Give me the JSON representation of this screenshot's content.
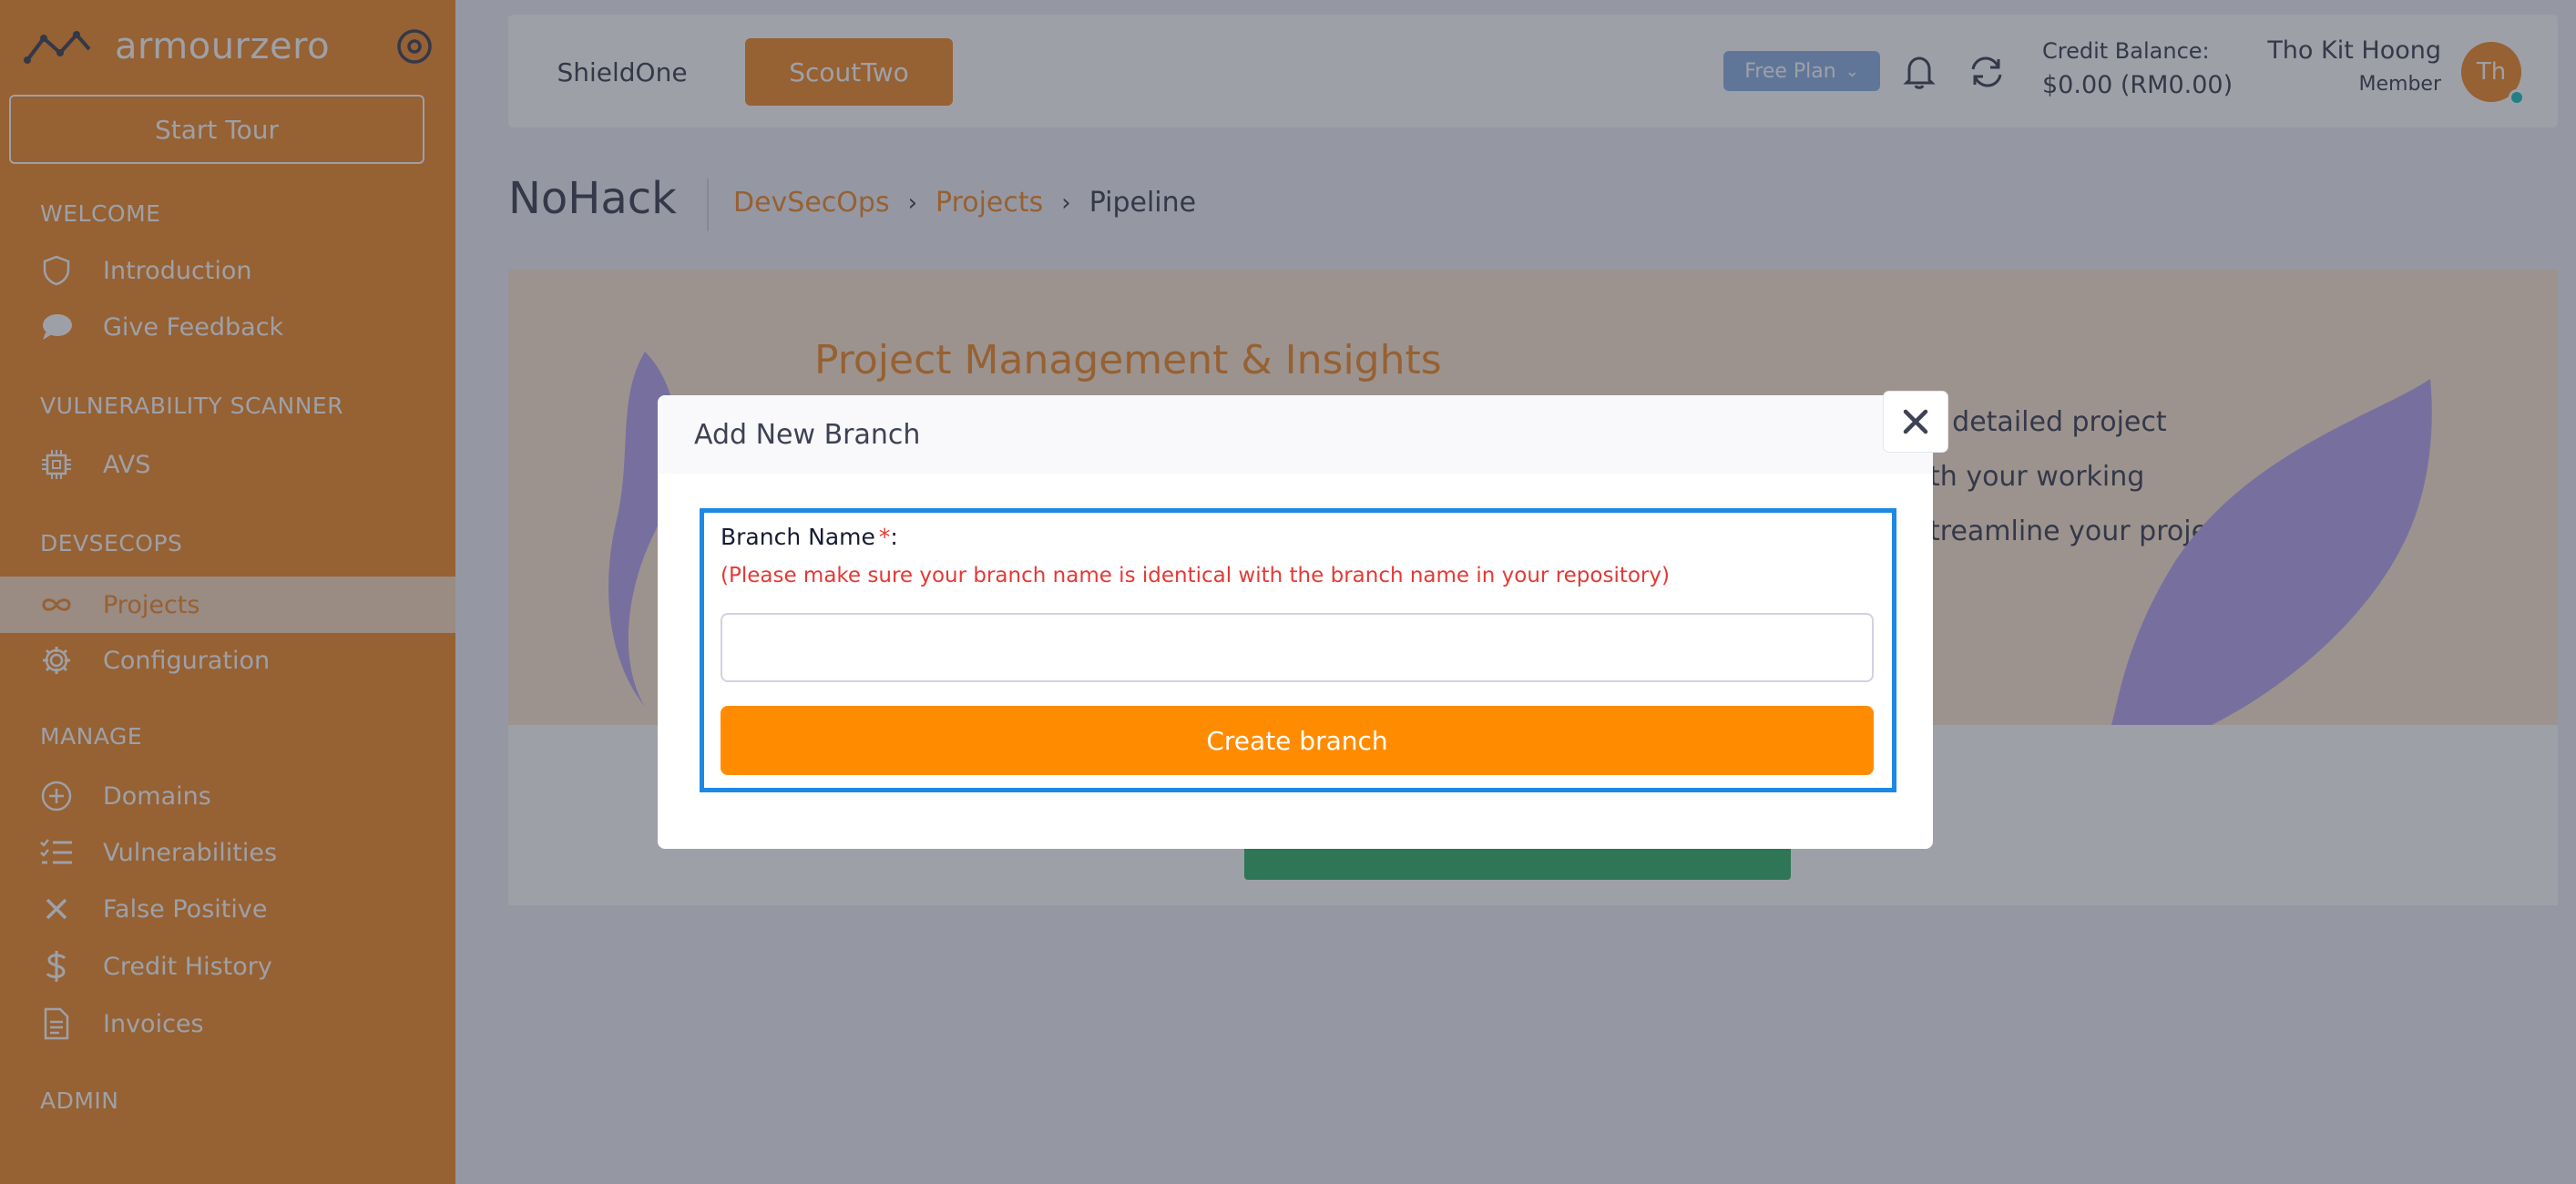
{
  "sidebar": {
    "brand_name": "armourzero",
    "start_tour_label": "Start Tour",
    "sections": {
      "welcome": "WELCOME",
      "vuln_scanner": "VULNERABILITY SCANNER",
      "devsecops": "DEVSECOPS",
      "manage": "MANAGE",
      "admin": "ADMIN"
    },
    "items": {
      "introduction": "Introduction",
      "give_feedback": "Give Feedback",
      "avs": "AVS",
      "projects": "Projects",
      "configuration": "Configuration",
      "domains": "Domains",
      "vulnerabilities": "Vulnerabilities",
      "false_positive": "False Positive",
      "credit_history": "Credit History",
      "invoices": "Invoices"
    },
    "active_item": "projects"
  },
  "header": {
    "tabs": {
      "shield": "ShieldOne",
      "scout": "ScoutTwo"
    },
    "active_tab": "scout",
    "plan_badge": "Free Plan",
    "credit_label": "Credit Balance:",
    "credit_value": "$0.00 (RM0.00)",
    "user_name": "Tho Kit Hoong",
    "user_role": "Member",
    "avatar_initials": "Th"
  },
  "page": {
    "title": "NoHack",
    "breadcrumb": [
      "DevSecOps",
      "Projects",
      "Pipeline"
    ]
  },
  "banner": {
    "title": "Project Management & Insights",
    "lines": [
      "s detailed project",
      "th your working",
      "treamline your project"
    ]
  },
  "modal": {
    "title": "Add New Branch",
    "field_label": "Branch Name",
    "required_mark": "*",
    "label_suffix": ":",
    "hint": "(Please make sure your branch name is identical with the branch name in your repository)",
    "input_value": "",
    "submit_label": "Create branch"
  },
  "colors": {
    "brand_orange": "#f08c2c",
    "button_orange": "#ff8c00",
    "error_red": "#e53935",
    "focus_blue": "#1e88e5",
    "plan_badge": "#8fb3e6"
  }
}
